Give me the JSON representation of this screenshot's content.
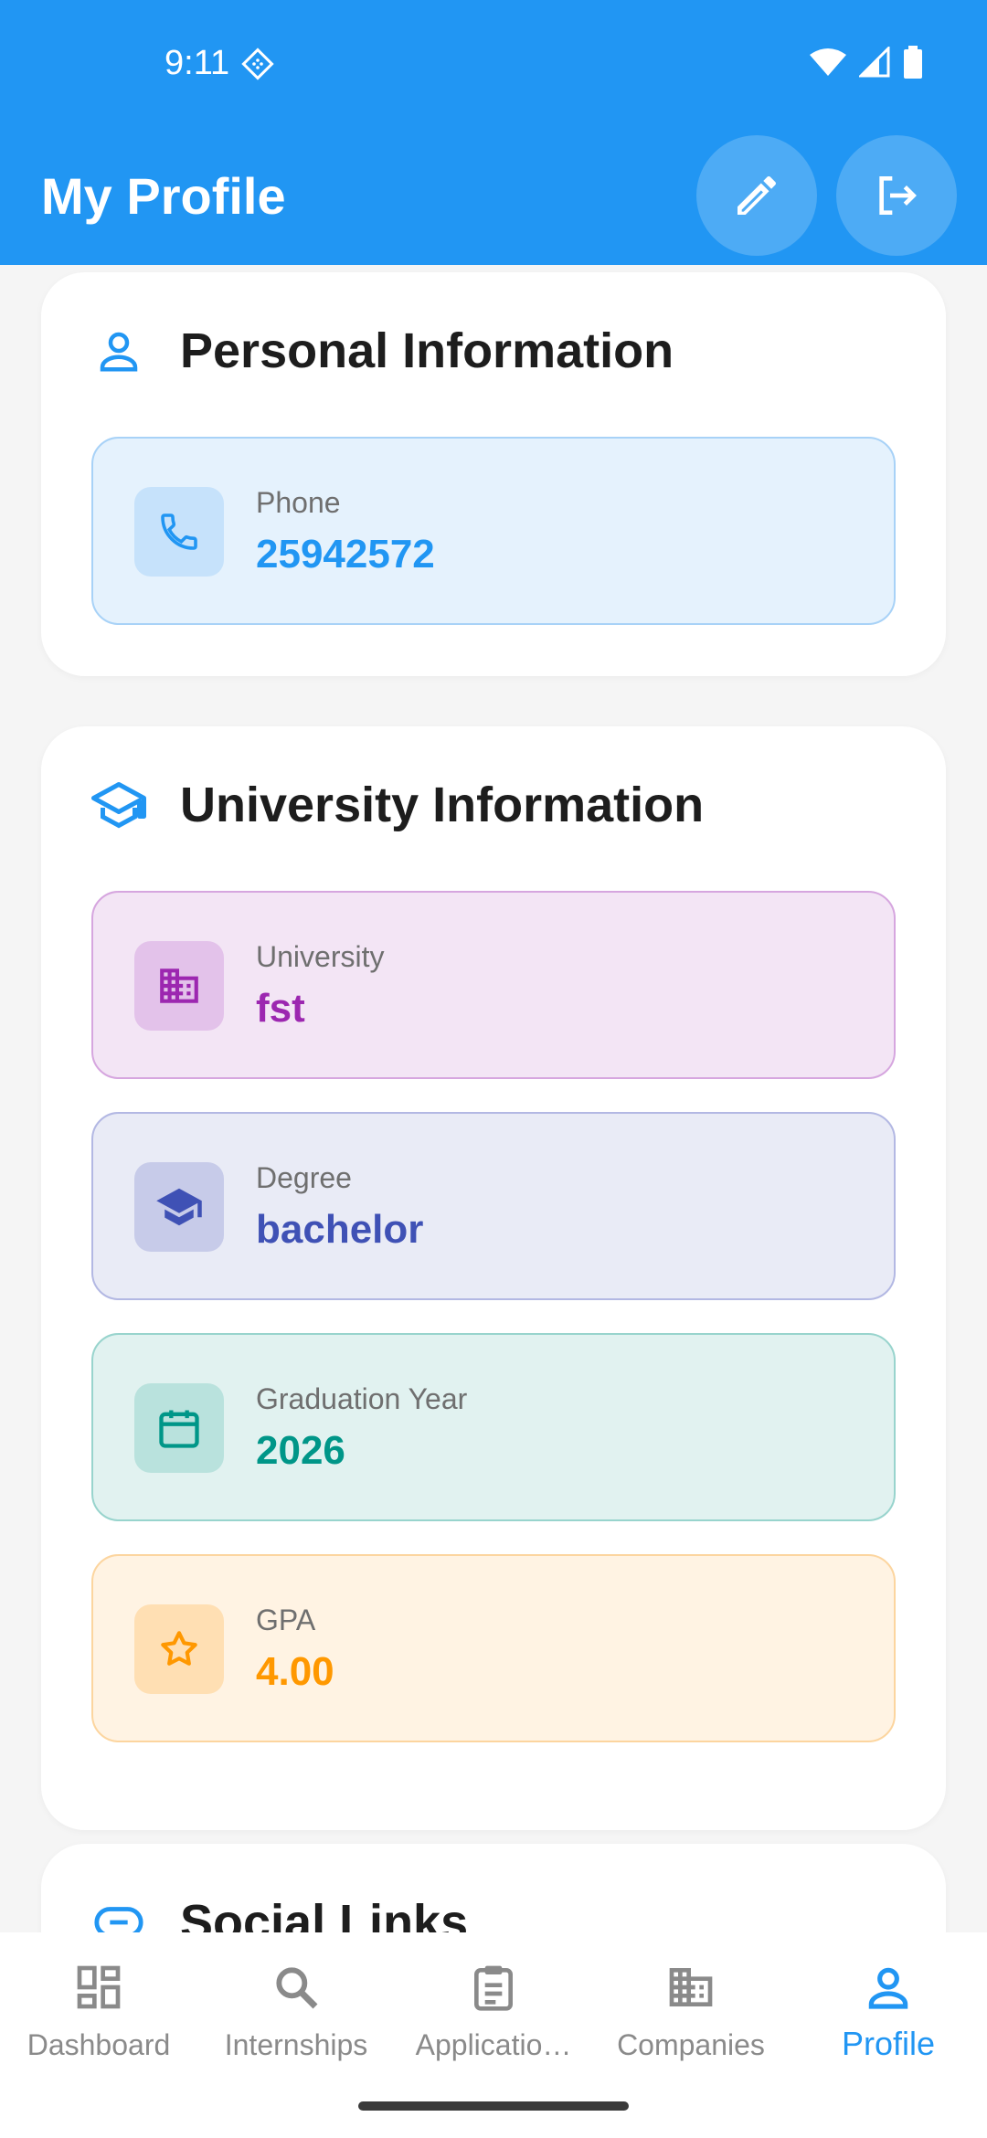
{
  "status_bar": {
    "time": "9:11"
  },
  "app_bar": {
    "title": "My Profile"
  },
  "personal": {
    "title": "Personal Information",
    "phone": {
      "label": "Phone",
      "value": "25942572"
    }
  },
  "university": {
    "title": "University Information",
    "items": [
      {
        "label": "University",
        "value": "fst"
      },
      {
        "label": "Degree",
        "value": "bachelor"
      },
      {
        "label": "Graduation Year",
        "value": "2026"
      },
      {
        "label": "GPA",
        "value": "4.00"
      }
    ]
  },
  "social": {
    "title": "Social Links"
  },
  "nav": {
    "items": [
      {
        "label": "Dashboard",
        "icon": "dashboard-icon"
      },
      {
        "label": "Internships",
        "icon": "search-icon"
      },
      {
        "label": "Applicatio…",
        "icon": "clipboard-icon"
      },
      {
        "label": "Companies",
        "icon": "building-icon"
      },
      {
        "label": "Profile",
        "icon": "person-icon",
        "active": true
      }
    ]
  },
  "colors": {
    "primary": "#2196f3",
    "purple": "#9c27b0",
    "indigo": "#3f51b5",
    "teal": "#009688",
    "orange": "#ff9800"
  }
}
